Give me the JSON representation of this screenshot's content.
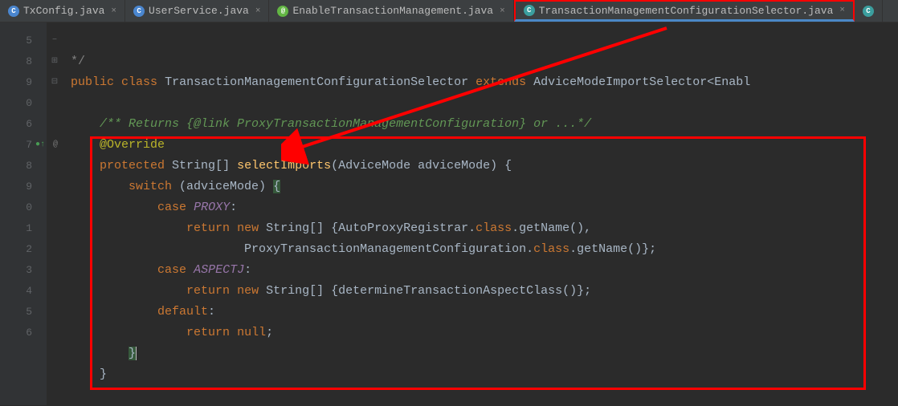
{
  "tabs": [
    {
      "label": "TxConfig.java",
      "icon": "c-blue"
    },
    {
      "label": "UserService.java",
      "icon": "c-blue"
    },
    {
      "label": "EnableTransactionManagement.java",
      "icon": "c-green"
    },
    {
      "label": "TransactionManagementConfigurationSelector.java",
      "icon": "c-teal",
      "highlighted": true,
      "active": true
    }
  ],
  "gutter": [
    "5",
    "8",
    "9",
    "0",
    "6",
    "7",
    "8",
    "9",
    "0",
    "1",
    "2",
    "3",
    "4",
    "5",
    "6",
    ""
  ],
  "gutter_at": "@",
  "fold": [
    "−",
    "",
    "",
    "⊞",
    "",
    "",
    "⊟",
    "",
    "",
    "",
    "",
    "",
    "",
    "",
    "",
    ""
  ],
  "code": {
    "l0": "*/",
    "kw_public": "public",
    "kw_class": "class",
    "cls_main": "TransactionManagementConfigurationSelector",
    "kw_extends": "extends",
    "cls_ext": "AdviceModeImportSelector",
    "lt": "<",
    "gen": "Enabl",
    "l2": "",
    "com_javadoc": "/** Returns {@link ProxyTransactionManagementConfiguration} or ...*/",
    "ann_override": "@Override",
    "kw_protected": "protected",
    "type_str": "String",
    "mth_sel": "selectImports",
    "param": "(AdviceMode adviceMode) {",
    "kw_switch": "switch",
    "sw_expr": " (adviceMode) ",
    "brace_open": "{",
    "kw_case": "case",
    "case_proxy": "PROXY",
    "colon": ":",
    "kw_return": "return",
    "kw_new": "new",
    "arr_open": "String[] {",
    "m_auto": "AutoProxyRegistrar",
    "dot_class": ".",
    "kw_cls": "class",
    "m_getname": ".getName(),",
    "m_proxy": "ProxyTransactionManagementConfiguration",
    "m_getname2": ".getName()};",
    "case_aspectj": "ASPECTJ",
    "m_det": "determineTransactionAspectClass()};",
    "kw_default": "default",
    "kw_null": "null",
    "semi": ";",
    "brace_close": "}",
    "brace_close2": "}"
  }
}
